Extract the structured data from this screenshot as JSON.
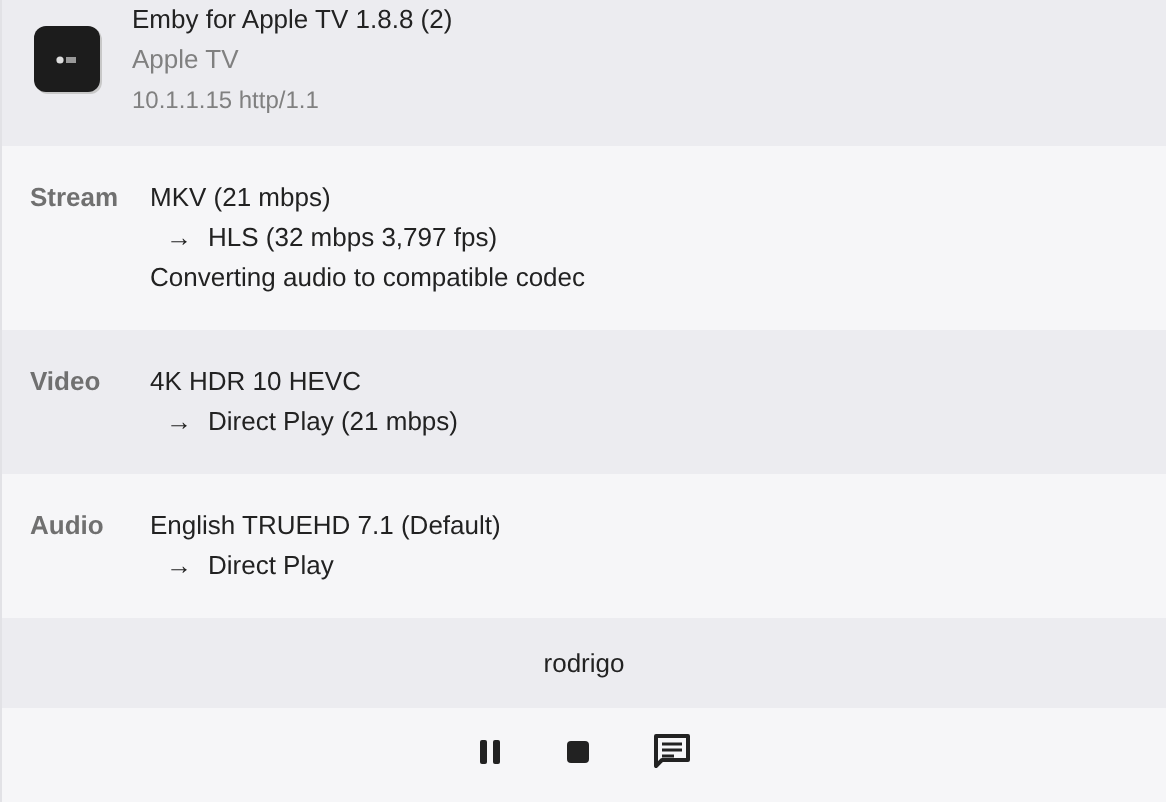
{
  "device": {
    "app": "Emby for Apple TV 1.8.8 (2)",
    "name": "Apple TV",
    "address": "10.1.1.15 http/1.1"
  },
  "details": [
    {
      "label": "Stream",
      "lines": [
        {
          "kind": "plain",
          "text": "MKV (21 mbps)"
        },
        {
          "kind": "arrow",
          "arrow": "→",
          "text": "HLS (32 mbps 3,797 fps)"
        },
        {
          "kind": "plain",
          "text": "Converting audio to compatible codec"
        }
      ]
    },
    {
      "label": "Video",
      "lines": [
        {
          "kind": "plain",
          "text": "4K HDR 10 HEVC"
        },
        {
          "kind": "arrow",
          "arrow": "→",
          "text": "Direct Play (21 mbps)"
        }
      ]
    },
    {
      "label": "Audio",
      "lines": [
        {
          "kind": "plain",
          "text": "English TRUEHD 7.1 (Default)"
        },
        {
          "kind": "arrow",
          "arrow": "→",
          "text": "Direct Play"
        }
      ]
    }
  ],
  "user": "rodrigo",
  "controls": [
    {
      "kind": "pause"
    },
    {
      "kind": "stop"
    },
    {
      "kind": "subtitles"
    }
  ]
}
